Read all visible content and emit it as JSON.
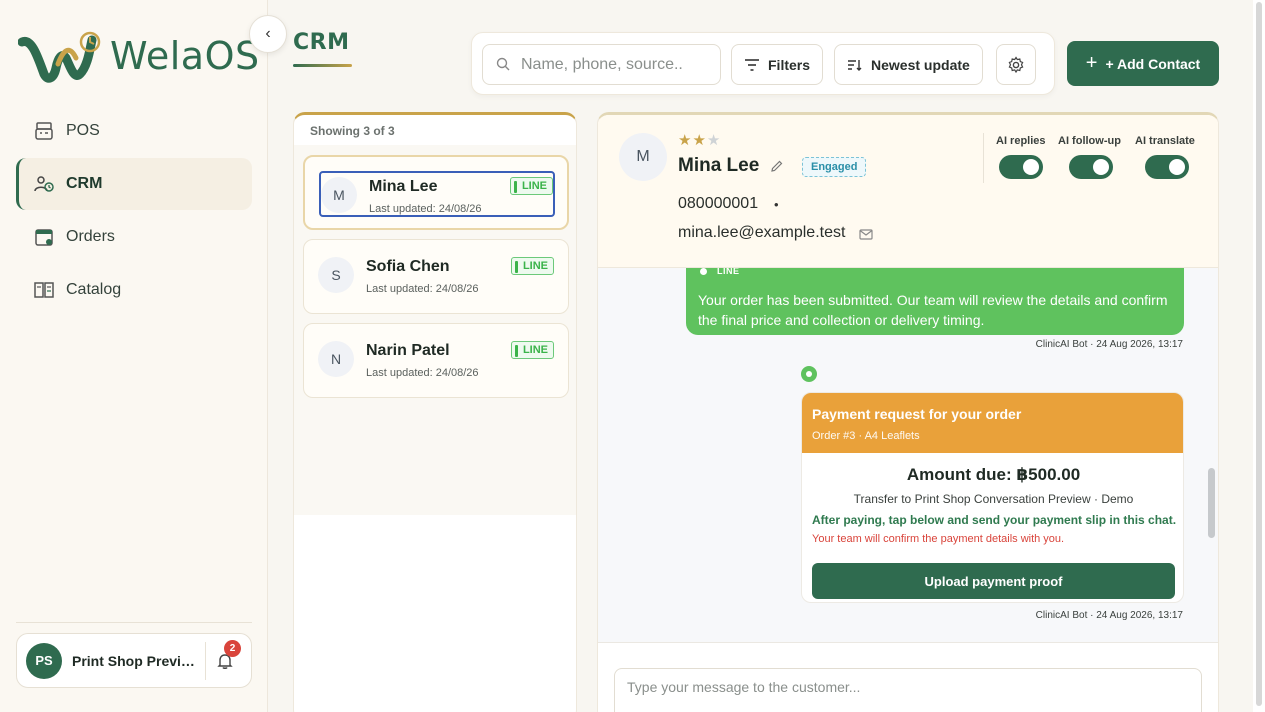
{
  "brand": {
    "name": "WelaOS"
  },
  "sidebar": {
    "items": [
      {
        "label": "POS",
        "icon": "register-icon"
      },
      {
        "label": "CRM",
        "icon": "crm-contacts-icon",
        "active": true
      },
      {
        "label": "Orders",
        "icon": "orders-calendar-icon"
      },
      {
        "label": "Catalog",
        "icon": "catalog-book-icon"
      }
    ],
    "account": {
      "initials": "PS",
      "name": "Print Shop Preview",
      "notifications": "2"
    }
  },
  "header": {
    "title": "CRM",
    "search_placeholder": "Name, phone, source..",
    "filters_label": "Filters",
    "sort_label": "Newest update",
    "add_contact_label": "+ Add Contact"
  },
  "list": {
    "showing": "Showing 3 of 3",
    "contacts": [
      {
        "initial": "M",
        "name": "Mina Lee",
        "updated": "Last updated: 24/08/26",
        "channel": "LINE",
        "selected": true
      },
      {
        "initial": "S",
        "name": "Sofia Chen",
        "updated": "Last updated: 24/08/26",
        "channel": "LINE"
      },
      {
        "initial": "N",
        "name": "Narin Patel",
        "updated": "Last updated: 24/08/26",
        "channel": "LINE"
      }
    ]
  },
  "contact": {
    "initial": "M",
    "name": "Mina Lee",
    "rating": 2,
    "rating_max": 3,
    "status": "Engaged",
    "phone": "080000001",
    "email": "mina.lee@example.test",
    "ai": [
      {
        "label": "AI replies",
        "on": true
      },
      {
        "label": "AI follow-up",
        "on": true
      },
      {
        "label": "AI translate",
        "on": true
      }
    ]
  },
  "messages": {
    "bot_message": {
      "channel": "LINE",
      "text": "Your order has been submitted. Our team will review the details and confirm the final price and collection or delivery timing.",
      "meta": "ClinicAI Bot · 24 Aug 2026, 13:17"
    },
    "payment": {
      "title": "Payment request for your order",
      "subtitle": "Order #3 · A4 Leaflets",
      "amount": "Amount due: ฿500.00",
      "transfer": "Transfer to Print Shop Conversation Preview · Demo",
      "instructions": "After paying, tap below and send your payment slip in this chat.",
      "confirm_note": "Your team will confirm the payment details with you.",
      "button": "Upload payment proof",
      "meta": "ClinicAI Bot · 24 Aug 2026, 13:17"
    }
  },
  "composer": {
    "placeholder": "Type your message to the customer..."
  },
  "colors": {
    "brand_green": "#2f6b4f",
    "gold": "#c9a34a",
    "line_green": "#5fc25e",
    "payment_orange": "#e9a13a",
    "alert_red": "#d9443b"
  }
}
